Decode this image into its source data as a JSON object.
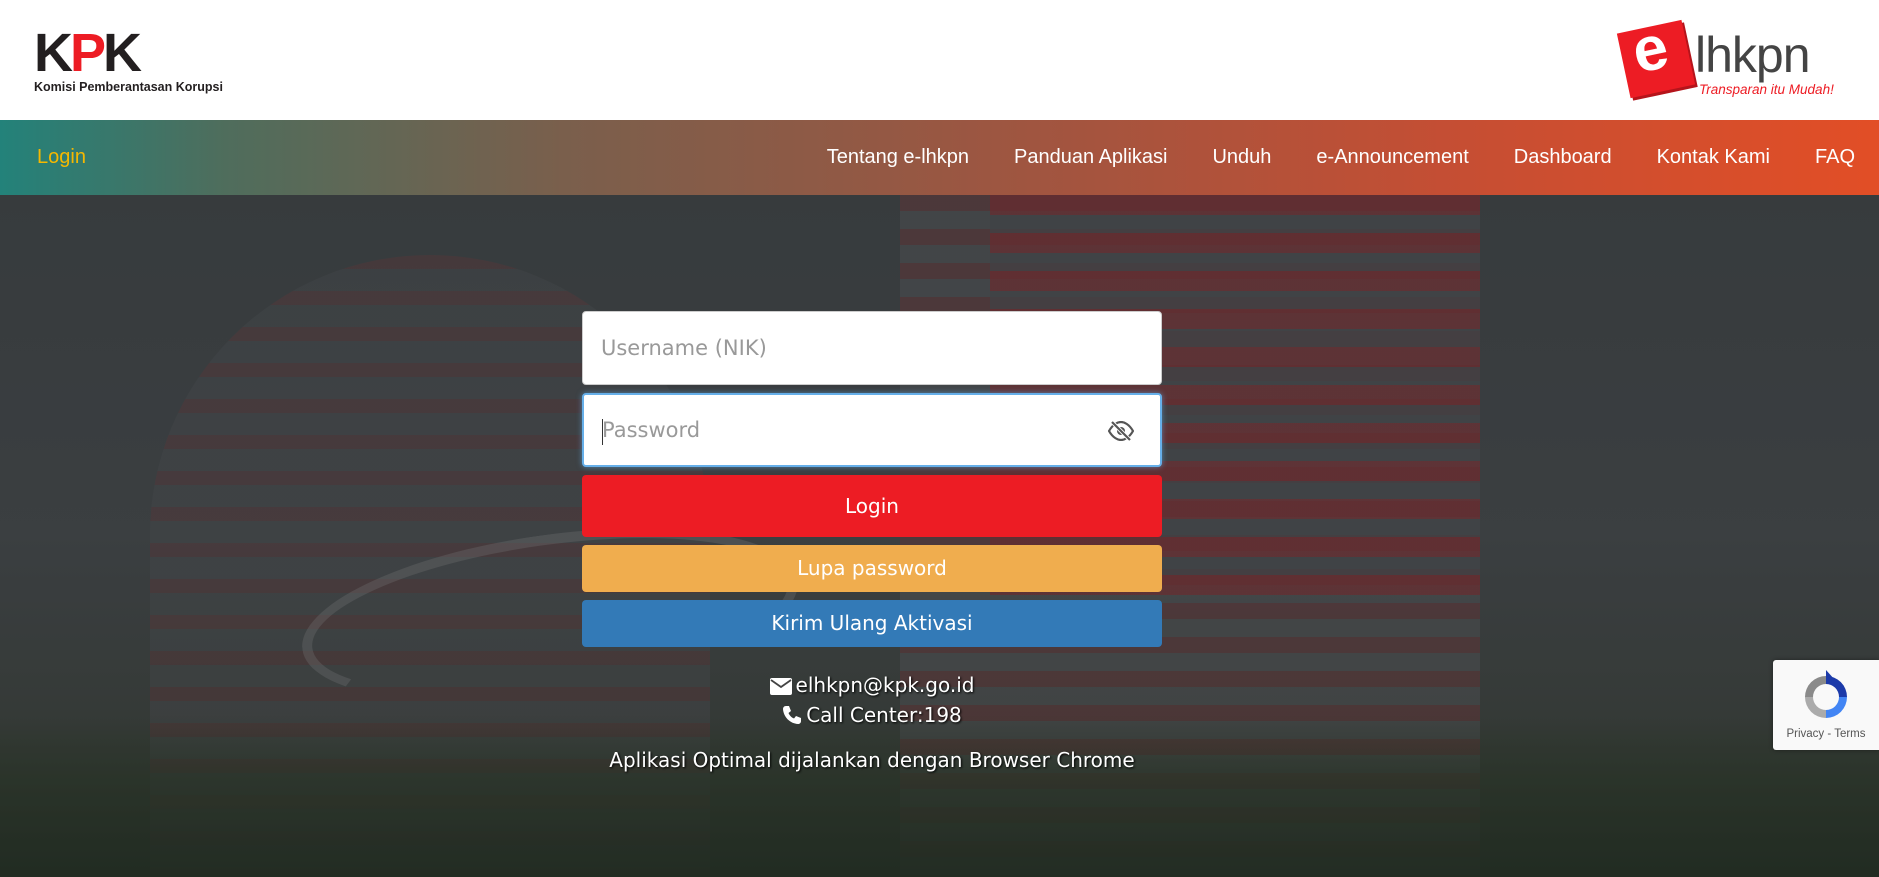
{
  "header": {
    "kpk_logo_text": "KPK",
    "kpk_subtitle": "Komisi Pemberantasan Korupsi",
    "elhkpn_logo_e": "e",
    "elhkpn_logo_text": "lhkpn",
    "elhkpn_tagline": "Transparan itu Mudah!"
  },
  "nav": {
    "brand": "Login",
    "items": [
      {
        "label": "Tentang e-lhkpn"
      },
      {
        "label": "Panduan Aplikasi"
      },
      {
        "label": "Unduh"
      },
      {
        "label": "e-Announcement"
      },
      {
        "label": "Dashboard"
      },
      {
        "label": "Kontak Kami"
      },
      {
        "label": "FAQ"
      }
    ]
  },
  "form": {
    "username_placeholder": "Username (NIK)",
    "username_value": "",
    "password_placeholder": "Password",
    "password_value": "",
    "login_label": "Login",
    "forgot_label": "Lupa password",
    "resend_label": "Kirim Ulang Aktivasi"
  },
  "contact": {
    "email": "elhkpn@kpk.go.id",
    "call_center": "Call Center:198",
    "browser_note": "Aplikasi Optimal dijalankan dengan Browser Chrome"
  },
  "recaptcha": {
    "privacy": "Privacy",
    "separator": " - ",
    "terms": "Terms"
  },
  "colors": {
    "brand_red": "#ed1c24",
    "nav_brand_yellow": "#f5b800",
    "lupa_orange": "#f0ad4e",
    "kirim_blue": "#337ab7",
    "nav_gradient_start": "#23827a",
    "nav_gradient_end": "#e24e26"
  },
  "icons": {
    "password_toggle": "eye-slash-icon",
    "email": "envelope-icon",
    "phone": "phone-icon",
    "recaptcha": "recaptcha-logo-icon"
  }
}
